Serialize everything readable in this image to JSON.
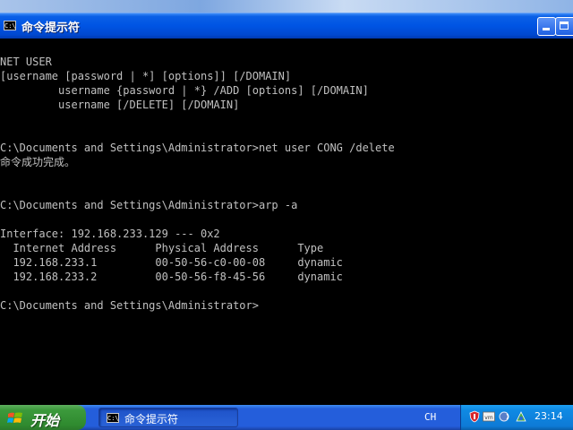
{
  "window": {
    "title": "命令提示符",
    "icon_label": "C:\\"
  },
  "console": {
    "lines": [
      "NET USER",
      "[username [password | *] [options]] [/DOMAIN]",
      "         username {password | *} /ADD [options] [/DOMAIN]",
      "         username [/DELETE] [/DOMAIN]",
      "",
      "",
      "C:\\Documents and Settings\\Administrator>net user CONG /delete",
      "命令成功完成。",
      "",
      "",
      "C:\\Documents and Settings\\Administrator>arp -a",
      "",
      "Interface: 192.168.233.129 --- 0x2",
      "  Internet Address      Physical Address      Type",
      "  192.168.233.1         00-50-56-c0-00-08     dynamic",
      "  192.168.233.2         00-50-56-f8-45-56     dynamic",
      "",
      "C:\\Documents and Settings\\Administrator>"
    ]
  },
  "taskbar": {
    "start_label": "开始",
    "task_label": "命令提示符",
    "task_icon_label": "C:\\",
    "language": "CH",
    "clock": "23:14",
    "tray_icons": [
      "shield-icon",
      "vmware-icon",
      "volume-icon",
      "network-icon"
    ]
  },
  "colors": {
    "console_bg": "#000000",
    "console_fg": "#c0c0c0",
    "titlebar": "#0054e3",
    "taskbar": "#245edb",
    "start": "#3c9a3c",
    "tray": "#0f8ae4"
  }
}
